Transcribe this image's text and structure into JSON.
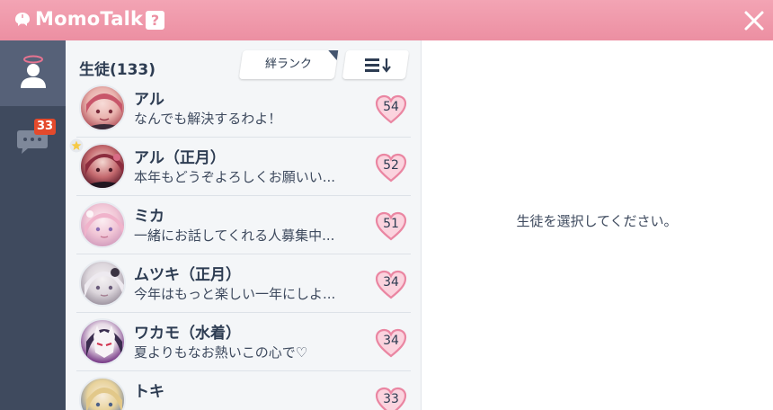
{
  "app": {
    "title": "MomoTalk",
    "help_label": "?"
  },
  "nav": {
    "students_icon": "person-icon",
    "chat_icon": "chat-bubble-icon",
    "unread_count": "33"
  },
  "list": {
    "header": "生徒(133)",
    "sort_label": "絆ランク",
    "order_icon": "sort-descending-icon",
    "students": [
      {
        "name": "アル",
        "message": "なんでも解決するわよ！",
        "bond": "54"
      },
      {
        "name": "アル（正月）",
        "message": "本年もどうぞよろしくお願いい...",
        "bond": "52"
      },
      {
        "name": "ミカ",
        "message": "一緒にお話してくれる人募集中...",
        "bond": "51"
      },
      {
        "name": "ムツキ（正月）",
        "message": "今年はもっと楽しい一年にしよ...",
        "bond": "34"
      },
      {
        "name": "ワカモ（水着）",
        "message": "夏よりもなお熱いこの心で♡",
        "bond": "34"
      },
      {
        "name": "トキ",
        "message": "",
        "bond": "33"
      }
    ]
  },
  "detail": {
    "empty_text": "生徒を選択してください。"
  },
  "colors": {
    "titlebar": "#ec8fa2",
    "rail": "#3f4a5e",
    "rail_active": "#566178",
    "badge": "#e44a2c",
    "heart_fill": "#fbd3de",
    "heart_stroke": "#ea86a2"
  }
}
